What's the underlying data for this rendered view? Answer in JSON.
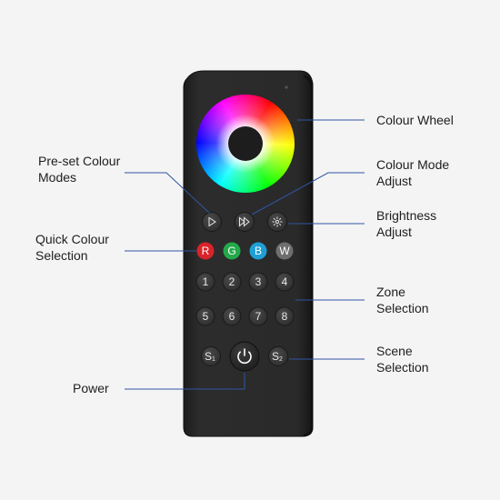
{
  "colors": {
    "background": "#f4f4f4",
    "remote_body": "#262626",
    "button": "#3a3a3a",
    "leader_line": "#2f55a3",
    "red_button": "#d8232a",
    "green_button": "#24a94a",
    "blue_button": "#1f9fd6",
    "white_button": "#6e6e6e"
  },
  "callouts": {
    "colour_wheel": "Colour Wheel",
    "preset_modes": "Pre-set Colour\nModes",
    "colour_mode_adjust": "Colour Mode\nAdjust",
    "brightness_adjust": "Brightness\nAdjust",
    "quick_colour": "Quick Colour\nSelection",
    "zone_selection": "Zone\nSelection",
    "scene_selection": "Scene\nSelection",
    "power": "Power"
  },
  "remote": {
    "colour_buttons": [
      "R",
      "G",
      "B",
      "W"
    ],
    "zone_buttons": [
      "1",
      "2",
      "3",
      "4",
      "5",
      "6",
      "7",
      "8"
    ],
    "scene_buttons": [
      {
        "letter": "S",
        "sub": "1"
      },
      {
        "letter": "S",
        "sub": "2"
      }
    ],
    "icons": {
      "play": "play-icon",
      "fast_forward": "fast-forward-icon",
      "brightness": "sun-icon",
      "power": "power-icon"
    }
  }
}
